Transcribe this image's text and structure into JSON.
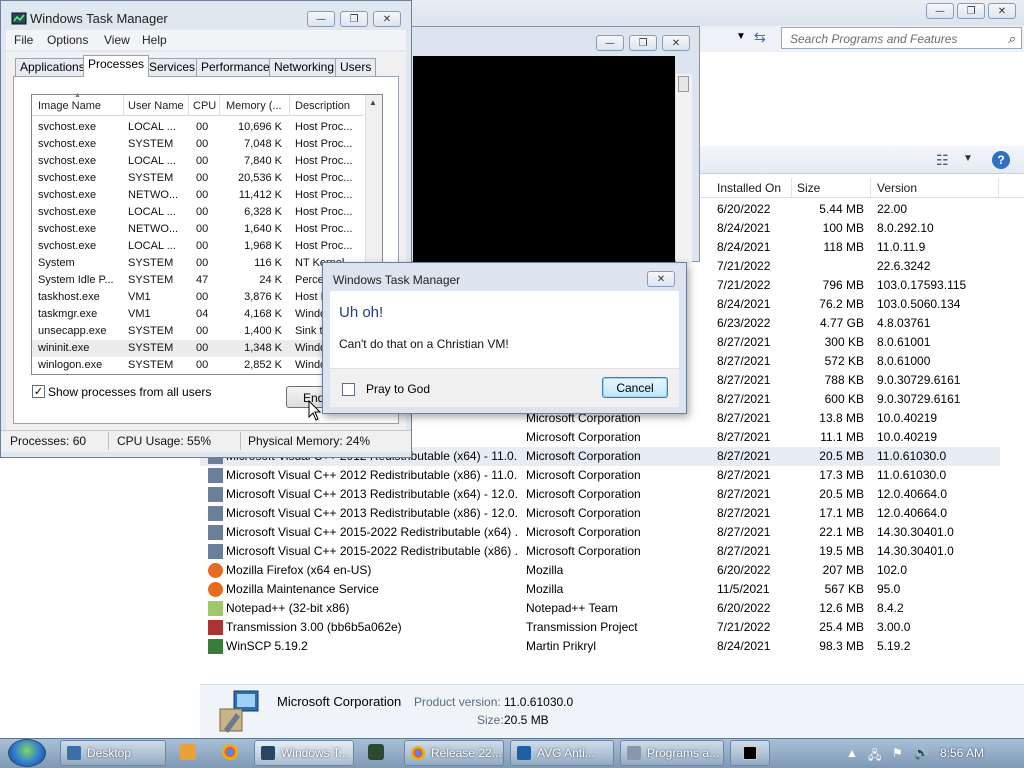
{
  "programs_features": {
    "search_placeholder": "Search Programs and Features",
    "columns": {
      "installed_on": "Installed On",
      "size": "Size",
      "version": "Version"
    },
    "rows": [
      {
        "name": "",
        "publisher": "",
        "date": "6/20/2022",
        "size": "5.44 MB",
        "version": "22.00"
      },
      {
        "name": "",
        "publisher": "",
        "date": "8/24/2021",
        "size": "100 MB",
        "version": "8.0.292.10"
      },
      {
        "name": "",
        "publisher": "",
        "date": "8/24/2021",
        "size": "118 MB",
        "version": "11.0.11.9"
      },
      {
        "name": "",
        "publisher": "",
        "date": "7/21/2022",
        "size": "",
        "version": "22.6.3242"
      },
      {
        "name": "",
        "publisher": "",
        "date": "7/21/2022",
        "size": "796 MB",
        "version": "103.0.17593.115"
      },
      {
        "name": "",
        "publisher": "",
        "date": "8/24/2021",
        "size": "76.2 MB",
        "version": "103.0.5060.134"
      },
      {
        "name": "",
        "publisher": "",
        "date": "6/23/2022",
        "size": "4.77 GB",
        "version": "4.8.03761"
      },
      {
        "name": "",
        "publisher": "",
        "date": "8/27/2021",
        "size": "300 KB",
        "version": "8.0.61001"
      },
      {
        "name": "",
        "publisher": "",
        "date": "8/27/2021",
        "size": "572 KB",
        "version": "8.0.61000"
      },
      {
        "name": "",
        "publisher": "",
        "date": "8/27/2021",
        "size": "788 KB",
        "version": "9.0.30729.6161"
      },
      {
        "name": "",
        "publisher": "",
        "date": "8/27/2021",
        "size": "600 KB",
        "version": "9.0.30729.6161"
      },
      {
        "name": "Redistributable - 10.0....",
        "publisher": "Microsoft Corporation",
        "date": "8/27/2021",
        "size": "13.8 MB",
        "version": "10.0.40219"
      },
      {
        "name": "Redistributable - 10.0....",
        "publisher": "Microsoft Corporation",
        "date": "8/27/2021",
        "size": "11.1 MB",
        "version": "10.0.40219"
      },
      {
        "name": "Microsoft Visual C++ 2012 Redistributable (x64) - 11.0...",
        "publisher": "Microsoft Corporation",
        "date": "8/27/2021",
        "size": "20.5 MB",
        "version": "11.0.61030.0"
      },
      {
        "name": "Microsoft Visual C++ 2012 Redistributable (x86) - 11.0...",
        "publisher": "Microsoft Corporation",
        "date": "8/27/2021",
        "size": "17.3 MB",
        "version": "11.0.61030.0"
      },
      {
        "name": "Microsoft Visual C++ 2013 Redistributable (x64) - 12.0...",
        "publisher": "Microsoft Corporation",
        "date": "8/27/2021",
        "size": "20.5 MB",
        "version": "12.0.40664.0"
      },
      {
        "name": "Microsoft Visual C++ 2013 Redistributable (x86) - 12.0...",
        "publisher": "Microsoft Corporation",
        "date": "8/27/2021",
        "size": "17.1 MB",
        "version": "12.0.40664.0"
      },
      {
        "name": "Microsoft Visual C++ 2015-2022 Redistributable (x64) ...",
        "publisher": "Microsoft Corporation",
        "date": "8/27/2021",
        "size": "22.1 MB",
        "version": "14.30.30401.0"
      },
      {
        "name": "Microsoft Visual C++ 2015-2022 Redistributable (x86) ...",
        "publisher": "Microsoft Corporation",
        "date": "8/27/2021",
        "size": "19.5 MB",
        "version": "14.30.30401.0"
      },
      {
        "name": "Mozilla Firefox (x64 en-US)",
        "publisher": "Mozilla",
        "date": "6/20/2022",
        "size": "207 MB",
        "version": "102.0"
      },
      {
        "name": "Mozilla Maintenance Service",
        "publisher": "Mozilla",
        "date": "11/5/2021",
        "size": "567 KB",
        "version": "95.0"
      },
      {
        "name": "Notepad++ (32-bit x86)",
        "publisher": "Notepad++ Team",
        "date": "6/20/2022",
        "size": "12.6 MB",
        "version": "8.4.2"
      },
      {
        "name": "Transmission 3.00 (bb6b5a062e)",
        "publisher": "Transmission Project",
        "date": "7/21/2022",
        "size": "25.4 MB",
        "version": "3.00.0"
      },
      {
        "name": "WinSCP 5.19.2",
        "publisher": "Martin Prikryl",
        "date": "8/24/2021",
        "size": "98.3 MB",
        "version": "5.19.2"
      }
    ],
    "details": {
      "publisher": "Microsoft Corporation",
      "product_version_label": "Product version:",
      "product_version": "11.0.61030.0",
      "size_label": "Size:",
      "size": "20.5 MB"
    }
  },
  "task_manager": {
    "title": "Windows Task Manager",
    "menu": [
      "File",
      "Options",
      "View",
      "Help"
    ],
    "tabs": [
      "Applications",
      "Processes",
      "Services",
      "Performance",
      "Networking",
      "Users"
    ],
    "columns": {
      "image_name": "Image Name",
      "user_name": "User Name",
      "cpu": "CPU",
      "memory": "Memory (...",
      "description": "Description"
    },
    "processes": [
      {
        "name": "svchost.exe",
        "user": "LOCAL ...",
        "cpu": "00",
        "mem": "10,696 K",
        "desc": "Host Proc..."
      },
      {
        "name": "svchost.exe",
        "user": "SYSTEM",
        "cpu": "00",
        "mem": "7,048 K",
        "desc": "Host Proc..."
      },
      {
        "name": "svchost.exe",
        "user": "LOCAL ...",
        "cpu": "00",
        "mem": "7,840 K",
        "desc": "Host Proc..."
      },
      {
        "name": "svchost.exe",
        "user": "SYSTEM",
        "cpu": "00",
        "mem": "20,536 K",
        "desc": "Host Proc..."
      },
      {
        "name": "svchost.exe",
        "user": "NETWO...",
        "cpu": "00",
        "mem": "11,412 K",
        "desc": "Host Proc..."
      },
      {
        "name": "svchost.exe",
        "user": "LOCAL ...",
        "cpu": "00",
        "mem": "6,328 K",
        "desc": "Host Proc..."
      },
      {
        "name": "svchost.exe",
        "user": "NETWO...",
        "cpu": "00",
        "mem": "1,640 K",
        "desc": "Host Proc..."
      },
      {
        "name": "svchost.exe",
        "user": "LOCAL ...",
        "cpu": "00",
        "mem": "1,968 K",
        "desc": "Host Proc..."
      },
      {
        "name": "System",
        "user": "SYSTEM",
        "cpu": "00",
        "mem": "116 K",
        "desc": "NT Kernel"
      },
      {
        "name": "System Idle P...",
        "user": "SYSTEM",
        "cpu": "47",
        "mem": "24 K",
        "desc": "Percentage"
      },
      {
        "name": "taskhost.exe",
        "user": "VM1",
        "cpu": "00",
        "mem": "3,876 K",
        "desc": "Host Proc"
      },
      {
        "name": "taskmgr.exe",
        "user": "VM1",
        "cpu": "04",
        "mem": "4,168 K",
        "desc": "Windows"
      },
      {
        "name": "unsecapp.exe",
        "user": "SYSTEM",
        "cpu": "00",
        "mem": "1,400 K",
        "desc": "Sink to"
      },
      {
        "name": "wininit.exe",
        "user": "SYSTEM",
        "cpu": "00",
        "mem": "1,348 K",
        "desc": "Windows"
      },
      {
        "name": "winlogon.exe",
        "user": "SYSTEM",
        "cpu": "00",
        "mem": "2,852 K",
        "desc": "Windows"
      }
    ],
    "show_all_label": "Show processes from all users",
    "show_all_checked": "✓",
    "end_button": "End",
    "status": {
      "processes": "Processes: 60",
      "cpu": "CPU Usage: 55%",
      "memory": "Physical Memory: 24%"
    }
  },
  "dialog": {
    "title": "Windows Task Manager",
    "heading": "Uh oh!",
    "message": "Can't do that on a Christian VM!",
    "checkbox_label": "Pray to God",
    "cancel": "Cancel"
  },
  "taskbar": {
    "items": [
      "Desktop",
      "Windows T...",
      "Release 22....",
      "AVG Anti...",
      "Programs a..."
    ],
    "clock": "8:56 AM"
  },
  "colors": {
    "accent": "#1e3f87",
    "selection": "#e8edf5",
    "taskbar": "#8fa8c3"
  }
}
